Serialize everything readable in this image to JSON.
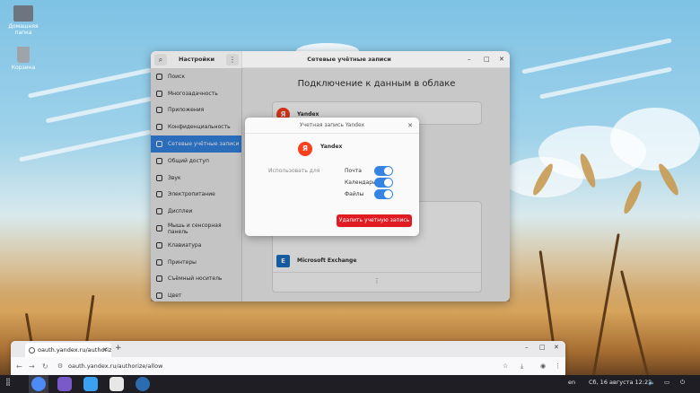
{
  "desktop": {
    "icons": [
      {
        "label": "Домашняя папка",
        "icon": "home-folder-icon"
      },
      {
        "label": "Корзина",
        "icon": "trash-icon"
      }
    ]
  },
  "settings": {
    "sidebar_title": "Настройки",
    "page_title": "Сетевые учётные записи",
    "heading": "Подключение к данным в облаке",
    "sidebar_items": [
      {
        "label": "Поиск",
        "icon": "search-icon"
      },
      {
        "label": "Многозадачность",
        "icon": "multitasking-icon"
      },
      {
        "label": "Приложения",
        "icon": "apps-icon"
      },
      {
        "label": "Конфиденциальность",
        "icon": "privacy-icon"
      },
      {
        "label": "Сетевые учётные записи",
        "icon": "online-accounts-icon",
        "active": true
      },
      {
        "label": "Общий доступ",
        "icon": "share-icon"
      },
      {
        "label": "Звук",
        "icon": "sound-icon"
      },
      {
        "label": "Электропитание",
        "icon": "power-icon"
      },
      {
        "label": "Дисплеи",
        "icon": "display-icon"
      },
      {
        "label": "Мышь и сенсорная панель",
        "icon": "mouse-icon"
      },
      {
        "label": "Клавиатура",
        "icon": "keyboard-icon"
      },
      {
        "label": "Принтеры",
        "icon": "printer-icon"
      },
      {
        "label": "Съёмный носитель",
        "icon": "removable-media-icon"
      },
      {
        "label": "Цвет",
        "icon": "color-icon"
      }
    ],
    "connected_account": {
      "name": "Yandex",
      "logo_letter": "Я"
    },
    "providers": [
      {
        "name": "Microsoft Exchange",
        "logo_letter": "E"
      }
    ],
    "more_label": "⋮"
  },
  "dialog": {
    "title": "Учетная запись Yandex",
    "account_name": "Yandex",
    "logo_letter": "Я",
    "use_for_label": "Использовать для",
    "services": [
      {
        "label": "Почта",
        "enabled": true
      },
      {
        "label": "Календарь",
        "enabled": true
      },
      {
        "label": "Файлы",
        "enabled": true
      }
    ],
    "remove_button": "Удалить учетную запись"
  },
  "browser": {
    "tab_title": "oauth.yandex.ru/authoriz",
    "url": "oauth.yandex.ru/authorize/allow",
    "new_tab": "+"
  },
  "taskbar": {
    "keyboard_layout": "en",
    "clock": "Сб, 16 августа  12:22"
  },
  "colors": {
    "accent": "#3584e4",
    "danger": "#e01b24",
    "yandex": "#fc3f1d"
  }
}
